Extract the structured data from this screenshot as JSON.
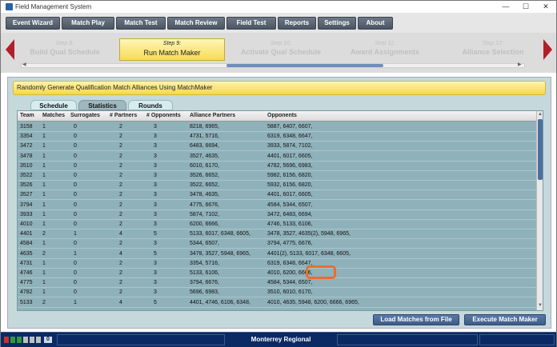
{
  "window": {
    "title": "Field Management System",
    "minimize": "—",
    "maximize": "☐",
    "close": "✕"
  },
  "menu": [
    "Event Wizard",
    "Match Play",
    "Match Test",
    "Match Review",
    "Field Test",
    "Reports",
    "Settings",
    "About"
  ],
  "wizard": {
    "prev_step": {
      "number": "Step 8:",
      "label": "Build Qual Schedule"
    },
    "active_step": {
      "number": "Step 9:",
      "label": "Run Match Maker"
    },
    "next_steps": [
      {
        "number": "Step 10:",
        "label": "Activate Qual Schedule"
      },
      {
        "number": "Step 11:",
        "label": "Award Assignments"
      },
      {
        "number": "Step 12:",
        "label": "Alliance Selection"
      }
    ]
  },
  "banner": "Randomly Generate Qualification Match Alliances Using MatchMaker",
  "tabs": [
    "Schedule",
    "Statistics",
    "Rounds"
  ],
  "active_tab": "Statistics",
  "table": {
    "columns": [
      "Team",
      "Matches",
      "Surrogates",
      "# Partners",
      "# Opponents",
      "Alliance Partners",
      "Opponents"
    ],
    "rows": [
      [
        "3158",
        "1",
        "0",
        "2",
        "3",
        "8218, 6965,",
        "5887, 6407, 6607,"
      ],
      [
        "3354",
        "1",
        "0",
        "2",
        "3",
        "4731, 5716,",
        "6319, 6348, 6647,"
      ],
      [
        "3472",
        "1",
        "0",
        "2",
        "3",
        "6483, 6694,",
        "3933, 5874, 7102,"
      ],
      [
        "3478",
        "1",
        "0",
        "2",
        "3",
        "3527, 4635,",
        "4401, 6017, 6605,"
      ],
      [
        "3510",
        "1",
        "0",
        "2",
        "3",
        "6010, 6170,",
        "4782, 5696, 6983,"
      ],
      [
        "3522",
        "1",
        "0",
        "2",
        "3",
        "3526, 6652,",
        "5982, 6156, 6820,"
      ],
      [
        "3526",
        "1",
        "0",
        "2",
        "3",
        "3522, 6652,",
        "5932, 6156, 6820,"
      ],
      [
        "3527",
        "1",
        "0",
        "2",
        "3",
        "3478, 4635,",
        "4401, 6017, 6605,"
      ],
      [
        "3794",
        "1",
        "0",
        "2",
        "3",
        "4775, 6676,",
        "4584, 5344, 6507,"
      ],
      [
        "3933",
        "1",
        "0",
        "2",
        "3",
        "5874, 7102,",
        "3472, 6483, 6694,"
      ],
      [
        "4010",
        "1",
        "0",
        "2",
        "3",
        "6200, 6666,",
        "4746, 5133, 6106,"
      ],
      [
        "4401",
        "2",
        "1",
        "4",
        "5",
        "5133, 6017, 6348, 6605,",
        "3478, 3527, 4635(2), 5948, 6965,"
      ],
      [
        "4584",
        "1",
        "0",
        "2",
        "3",
        "5344, 6507,",
        "3794, 4775, 6676,"
      ],
      [
        "4635",
        "2",
        "1",
        "4",
        "5",
        "3478, 3527, 5948, 6965,",
        "4401(2), 5133, 6017, 6348, 6605,"
      ],
      [
        "4731",
        "1",
        "0",
        "2",
        "3",
        "3354, 5716,",
        "6319, 6348, 6647,"
      ],
      [
        "4746",
        "1",
        "0",
        "2",
        "3",
        "5133, 6106,",
        "4010, 6200, 6666,"
      ],
      [
        "4775",
        "1",
        "0",
        "2",
        "3",
        "3794, 6676,",
        "4584, 5344, 6507,"
      ],
      [
        "4782",
        "1",
        "0",
        "2",
        "3",
        "5696, 6983,",
        "3510, 6010, 6170,"
      ],
      [
        "5133",
        "2",
        "1",
        "4",
        "5",
        "4401, 4746, 6106, 6348,",
        "4010, 4635, 5948, 6200, 6666, 6965,"
      ]
    ]
  },
  "highlight_text": "4635(2)",
  "buttons": {
    "load": "Load Matches from File",
    "execute": "Execute Match Maker"
  },
  "status": {
    "event": "Monterrey Regional",
    "count": "0"
  },
  "colors": {
    "accent": "#f5d84a",
    "highlight": "#ef6c2a",
    "status_bar": "#0b2a63",
    "arrow": "#b21f2a"
  }
}
